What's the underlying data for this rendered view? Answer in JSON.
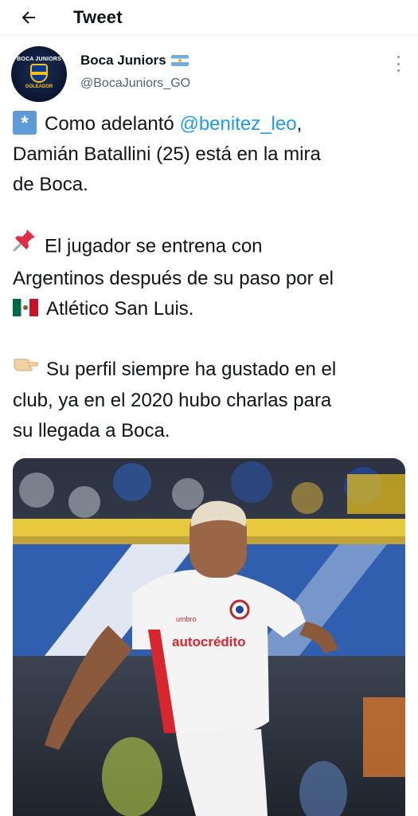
{
  "topbar": {
    "back_icon": "arrow-left-icon",
    "title": "Tweet"
  },
  "tweet": {
    "author": {
      "name": "Boca Juniors",
      "name_emoji": "flag-argentina-icon",
      "handle": "@BocaJuniors_GO",
      "avatar_text_top": "BOCA JUNIORS",
      "avatar_text_bottom": "GOLEADOR"
    },
    "more_icon": "more-vertical-icon",
    "paragraphs": [
      {
        "emoji": "asterisk-icon",
        "parts": [
          {
            "text": "Como adelantó ",
            "mention": false
          },
          {
            "text": "@benitez_leo",
            "mention": true
          },
          {
            "text": ",\nDamián Batallini (25) está en la mira\nde Boca.",
            "mention": false
          }
        ]
      },
      {
        "emoji": "pushpin-icon",
        "parts": [
          {
            "text": "El jugador se entrena con\nArgentinos después de su paso por el\n",
            "mention": false
          },
          {
            "text": "[flag-mexico]",
            "mention": false
          },
          {
            "text": "Atlético San Luis.",
            "mention": false
          }
        ]
      },
      {
        "emoji": "pointing-hand-icon",
        "parts": [
          {
            "text": "Su perfil siempre ha gustado en el\nclub, ya en el 2020 hubo charlas para\nsu llegada a Boca.",
            "mention": false
          }
        ]
      }
    ],
    "photo": {
      "jersey_sponsor": "autocrédito",
      "jersey_brand": "umbro"
    }
  },
  "colors": {
    "mention": "#1d9bf0",
    "secondary": "#536471",
    "text": "#0f1419"
  }
}
